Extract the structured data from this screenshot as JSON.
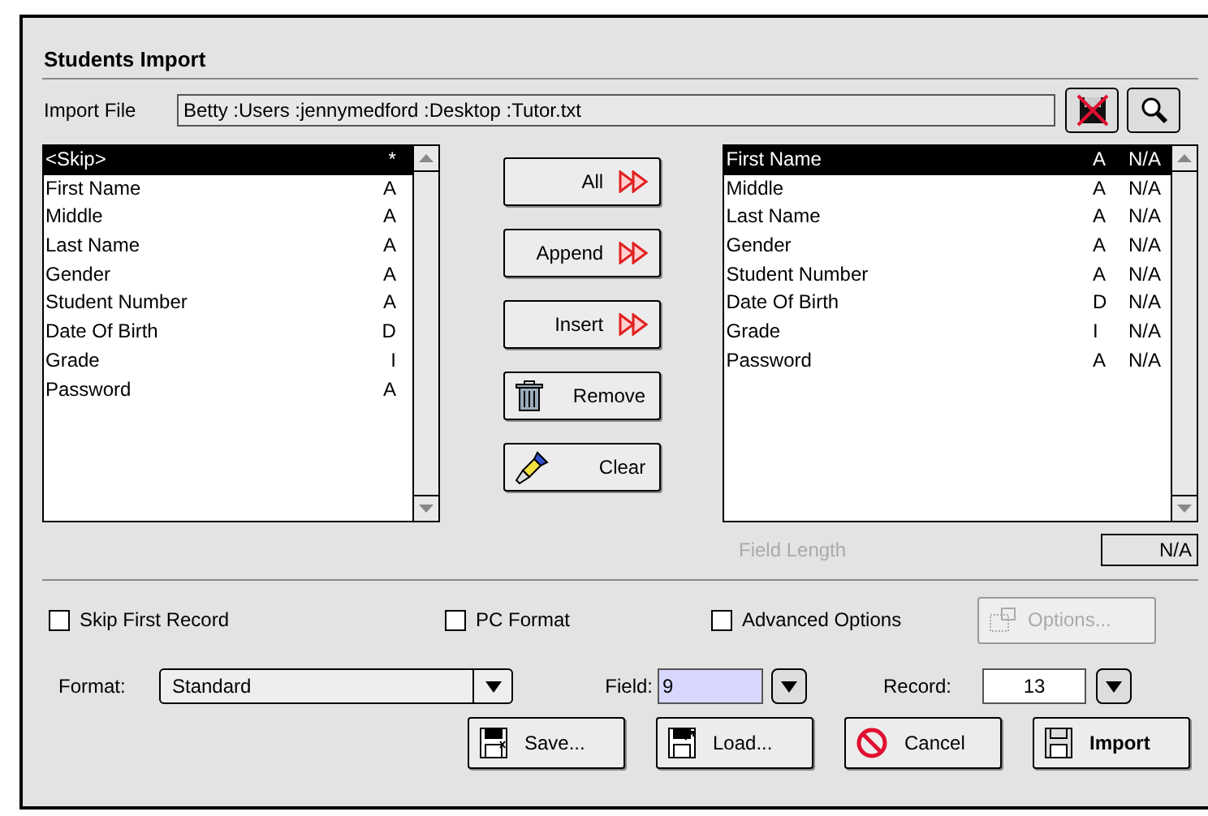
{
  "window": {
    "title": "Students Import"
  },
  "import_file": {
    "label": "Import File",
    "value": "Betty :Users :jennymedford :Desktop :Tutor.txt"
  },
  "source_list": {
    "rows": [
      {
        "name": "<Skip>",
        "type": "*",
        "selected": true
      },
      {
        "name": "First Name",
        "type": "A",
        "selected": false
      },
      {
        "name": "Middle",
        "type": "A",
        "selected": false
      },
      {
        "name": "Last Name",
        "type": "A",
        "selected": false
      },
      {
        "name": "Gender",
        "type": "A",
        "selected": false
      },
      {
        "name": "Student Number",
        "type": "A",
        "selected": false
      },
      {
        "name": "Date Of Birth",
        "type": "D",
        "selected": false
      },
      {
        "name": "Grade",
        "type": "I",
        "selected": false
      },
      {
        "name": "Password",
        "type": "A",
        "selected": false
      }
    ]
  },
  "move_buttons": [
    {
      "label": "All",
      "kind": "arrows"
    },
    {
      "label": "Append",
      "kind": "arrows"
    },
    {
      "label": "Insert",
      "kind": "arrows"
    },
    {
      "label": "Remove",
      "kind": "trash"
    },
    {
      "label": "Clear",
      "kind": "brush"
    }
  ],
  "target_list": {
    "rows": [
      {
        "name": "First Name",
        "type": "A",
        "length": "N/A",
        "selected": true
      },
      {
        "name": "Middle",
        "type": "A",
        "length": "N/A",
        "selected": false
      },
      {
        "name": "Last Name",
        "type": "A",
        "length": "N/A",
        "selected": false
      },
      {
        "name": "Gender",
        "type": "A",
        "length": "N/A",
        "selected": false
      },
      {
        "name": "Student Number",
        "type": "A",
        "length": "N/A",
        "selected": false
      },
      {
        "name": "Date Of Birth",
        "type": "D",
        "length": "N/A",
        "selected": false
      },
      {
        "name": "Grade",
        "type": "I",
        "length": "N/A",
        "selected": false
      },
      {
        "name": "Password",
        "type": "A",
        "length": "N/A",
        "selected": false
      }
    ]
  },
  "field_length": {
    "label": "Field Length",
    "value": "N/A",
    "disabled": true
  },
  "options": [
    {
      "label": "Skip First Record",
      "checked": false
    },
    {
      "label": "PC Format",
      "checked": false
    },
    {
      "label": "Advanced Options",
      "checked": false
    }
  ],
  "options_button": {
    "label": "Options...",
    "disabled": true
  },
  "format": {
    "label": "Format:",
    "value": "Standard"
  },
  "field": {
    "label": "Field:",
    "value": "9"
  },
  "record": {
    "label": "Record:",
    "value": "13"
  },
  "actions": [
    {
      "label": "Save...",
      "kind": "save",
      "default": false
    },
    {
      "label": "Load...",
      "kind": "load",
      "default": false
    },
    {
      "label": "Cancel",
      "kind": "cancel",
      "default": false
    },
    {
      "label": "Import",
      "kind": "import",
      "default": true
    }
  ]
}
